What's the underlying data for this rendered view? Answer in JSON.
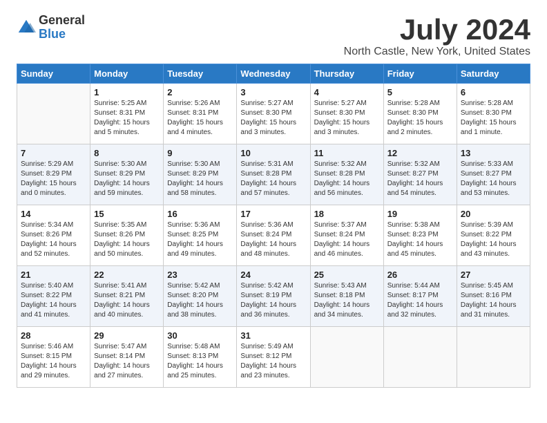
{
  "header": {
    "logo_general": "General",
    "logo_blue": "Blue",
    "month": "July 2024",
    "location": "North Castle, New York, United States"
  },
  "weekdays": [
    "Sunday",
    "Monday",
    "Tuesday",
    "Wednesday",
    "Thursday",
    "Friday",
    "Saturday"
  ],
  "weeks": [
    [
      {
        "day": "",
        "content": ""
      },
      {
        "day": "1",
        "content": "Sunrise: 5:25 AM\nSunset: 8:31 PM\nDaylight: 15 hours\nand 5 minutes."
      },
      {
        "day": "2",
        "content": "Sunrise: 5:26 AM\nSunset: 8:31 PM\nDaylight: 15 hours\nand 4 minutes."
      },
      {
        "day": "3",
        "content": "Sunrise: 5:27 AM\nSunset: 8:30 PM\nDaylight: 15 hours\nand 3 minutes."
      },
      {
        "day": "4",
        "content": "Sunrise: 5:27 AM\nSunset: 8:30 PM\nDaylight: 15 hours\nand 3 minutes."
      },
      {
        "day": "5",
        "content": "Sunrise: 5:28 AM\nSunset: 8:30 PM\nDaylight: 15 hours\nand 2 minutes."
      },
      {
        "day": "6",
        "content": "Sunrise: 5:28 AM\nSunset: 8:30 PM\nDaylight: 15 hours\nand 1 minute."
      }
    ],
    [
      {
        "day": "7",
        "content": "Sunrise: 5:29 AM\nSunset: 8:29 PM\nDaylight: 15 hours\nand 0 minutes."
      },
      {
        "day": "8",
        "content": "Sunrise: 5:30 AM\nSunset: 8:29 PM\nDaylight: 14 hours\nand 59 minutes."
      },
      {
        "day": "9",
        "content": "Sunrise: 5:30 AM\nSunset: 8:29 PM\nDaylight: 14 hours\nand 58 minutes."
      },
      {
        "day": "10",
        "content": "Sunrise: 5:31 AM\nSunset: 8:28 PM\nDaylight: 14 hours\nand 57 minutes."
      },
      {
        "day": "11",
        "content": "Sunrise: 5:32 AM\nSunset: 8:28 PM\nDaylight: 14 hours\nand 56 minutes."
      },
      {
        "day": "12",
        "content": "Sunrise: 5:32 AM\nSunset: 8:27 PM\nDaylight: 14 hours\nand 54 minutes."
      },
      {
        "day": "13",
        "content": "Sunrise: 5:33 AM\nSunset: 8:27 PM\nDaylight: 14 hours\nand 53 minutes."
      }
    ],
    [
      {
        "day": "14",
        "content": "Sunrise: 5:34 AM\nSunset: 8:26 PM\nDaylight: 14 hours\nand 52 minutes."
      },
      {
        "day": "15",
        "content": "Sunrise: 5:35 AM\nSunset: 8:26 PM\nDaylight: 14 hours\nand 50 minutes."
      },
      {
        "day": "16",
        "content": "Sunrise: 5:36 AM\nSunset: 8:25 PM\nDaylight: 14 hours\nand 49 minutes."
      },
      {
        "day": "17",
        "content": "Sunrise: 5:36 AM\nSunset: 8:24 PM\nDaylight: 14 hours\nand 48 minutes."
      },
      {
        "day": "18",
        "content": "Sunrise: 5:37 AM\nSunset: 8:24 PM\nDaylight: 14 hours\nand 46 minutes."
      },
      {
        "day": "19",
        "content": "Sunrise: 5:38 AM\nSunset: 8:23 PM\nDaylight: 14 hours\nand 45 minutes."
      },
      {
        "day": "20",
        "content": "Sunrise: 5:39 AM\nSunset: 8:22 PM\nDaylight: 14 hours\nand 43 minutes."
      }
    ],
    [
      {
        "day": "21",
        "content": "Sunrise: 5:40 AM\nSunset: 8:22 PM\nDaylight: 14 hours\nand 41 minutes."
      },
      {
        "day": "22",
        "content": "Sunrise: 5:41 AM\nSunset: 8:21 PM\nDaylight: 14 hours\nand 40 minutes."
      },
      {
        "day": "23",
        "content": "Sunrise: 5:42 AM\nSunset: 8:20 PM\nDaylight: 14 hours\nand 38 minutes."
      },
      {
        "day": "24",
        "content": "Sunrise: 5:42 AM\nSunset: 8:19 PM\nDaylight: 14 hours\nand 36 minutes."
      },
      {
        "day": "25",
        "content": "Sunrise: 5:43 AM\nSunset: 8:18 PM\nDaylight: 14 hours\nand 34 minutes."
      },
      {
        "day": "26",
        "content": "Sunrise: 5:44 AM\nSunset: 8:17 PM\nDaylight: 14 hours\nand 32 minutes."
      },
      {
        "day": "27",
        "content": "Sunrise: 5:45 AM\nSunset: 8:16 PM\nDaylight: 14 hours\nand 31 minutes."
      }
    ],
    [
      {
        "day": "28",
        "content": "Sunrise: 5:46 AM\nSunset: 8:15 PM\nDaylight: 14 hours\nand 29 minutes."
      },
      {
        "day": "29",
        "content": "Sunrise: 5:47 AM\nSunset: 8:14 PM\nDaylight: 14 hours\nand 27 minutes."
      },
      {
        "day": "30",
        "content": "Sunrise: 5:48 AM\nSunset: 8:13 PM\nDaylight: 14 hours\nand 25 minutes."
      },
      {
        "day": "31",
        "content": "Sunrise: 5:49 AM\nSunset: 8:12 PM\nDaylight: 14 hours\nand 23 minutes."
      },
      {
        "day": "",
        "content": ""
      },
      {
        "day": "",
        "content": ""
      },
      {
        "day": "",
        "content": ""
      }
    ]
  ]
}
